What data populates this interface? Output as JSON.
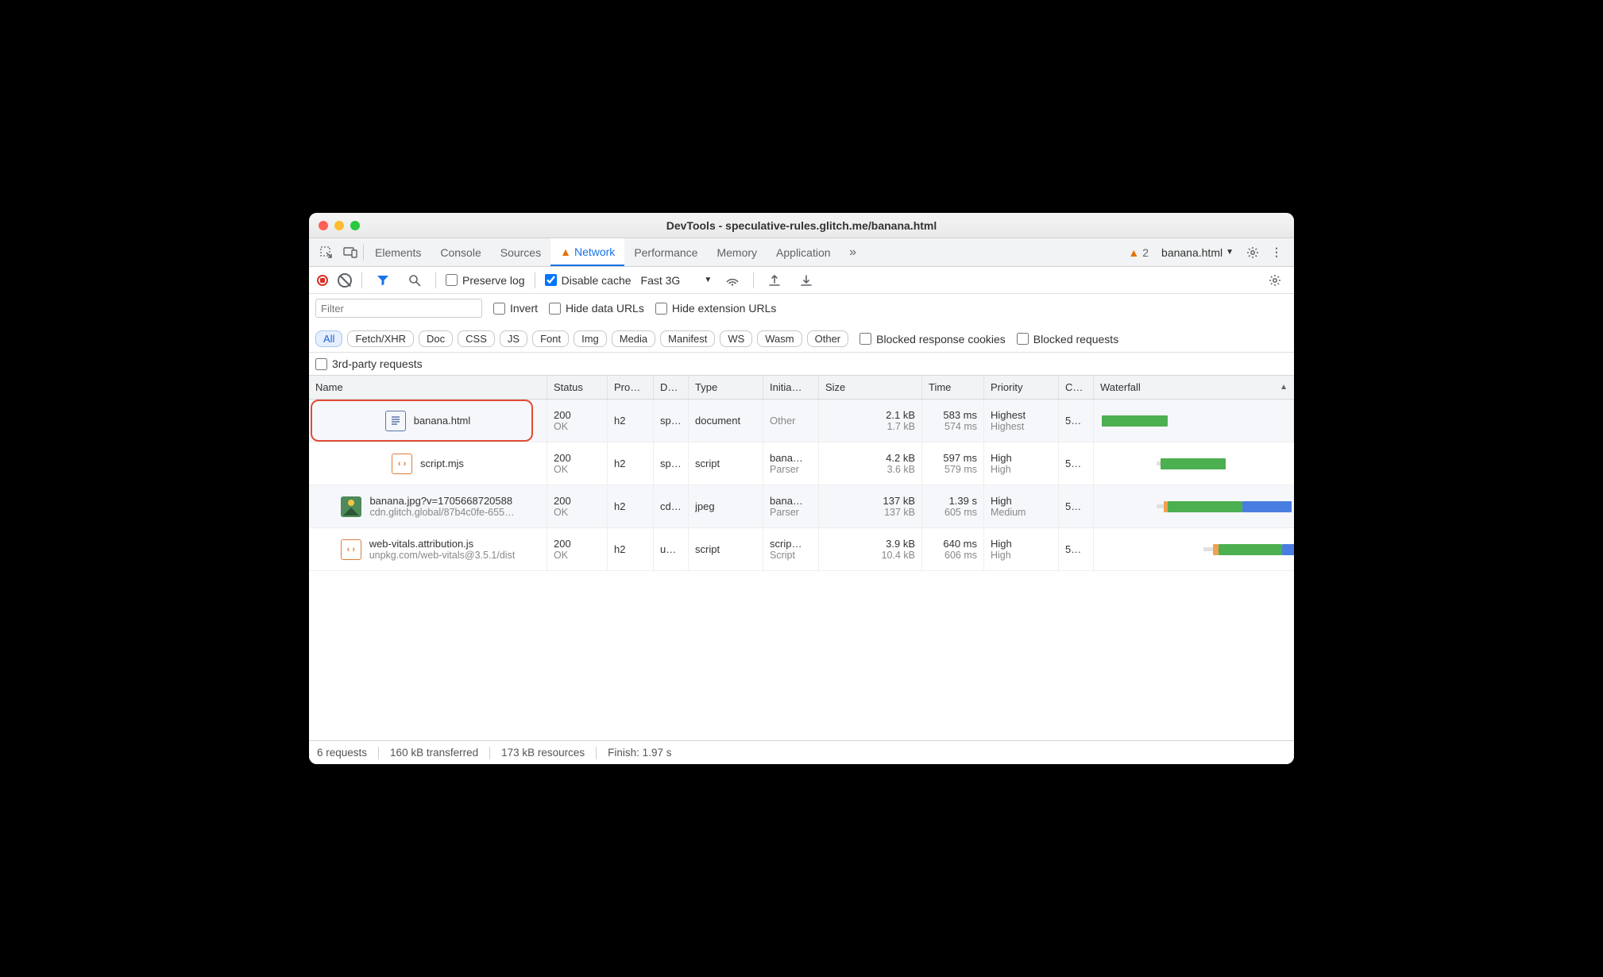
{
  "window": {
    "title": "DevTools - speculative-rules.glitch.me/banana.html"
  },
  "tabs": {
    "items": [
      "Elements",
      "Console",
      "Sources",
      "Network",
      "Performance",
      "Memory",
      "Application"
    ],
    "active": "Network",
    "warnCount": "2",
    "target": "banana.html"
  },
  "toolbar": {
    "preserveLog": "Preserve log",
    "disableCache": "Disable cache",
    "throttling": "Fast 3G"
  },
  "filters": {
    "placeholder": "Filter",
    "invert": "Invert",
    "hideData": "Hide data URLs",
    "hideExt": "Hide extension URLs",
    "types": [
      "All",
      "Fetch/XHR",
      "Doc",
      "CSS",
      "JS",
      "Font",
      "Img",
      "Media",
      "Manifest",
      "WS",
      "Wasm",
      "Other"
    ],
    "activeType": "All",
    "blockedCookies": "Blocked response cookies",
    "blockedReq": "Blocked requests",
    "thirdParty": "3rd-party requests"
  },
  "columns": {
    "name": "Name",
    "status": "Status",
    "proto": "Pro…",
    "domain": "D…",
    "type": "Type",
    "initiator": "Initia…",
    "size": "Size",
    "time": "Time",
    "priority": "Priority",
    "conn": "C…",
    "waterfall": "Waterfall"
  },
  "rows": [
    {
      "icon": "doc",
      "name": "banana.html",
      "sub": "",
      "status": "200",
      "statusText": "OK",
      "proto": "h2",
      "domain": "sp…",
      "type": "document",
      "initiator": "Other",
      "initiatorSub": "",
      "size": "2.1 kB",
      "sizeSub": "1.7 kB",
      "time": "583 ms",
      "timeSub": "574 ms",
      "prio": "Highest",
      "prioSub": "Highest",
      "conn": "5…",
      "wf": {
        "start": 1,
        "wait": 0,
        "green": 35,
        "blue": 0,
        "orange": 0
      }
    },
    {
      "icon": "js",
      "name": "script.mjs",
      "sub": "",
      "status": "200",
      "statusText": "OK",
      "proto": "h2",
      "domain": "sp…",
      "type": "script",
      "initiator": "bana…",
      "initiatorSub": "Parser",
      "size": "4.2 kB",
      "sizeSub": "3.6 kB",
      "time": "597 ms",
      "timeSub": "579 ms",
      "prio": "High",
      "prioSub": "High",
      "conn": "5…",
      "wf": {
        "start": 30,
        "wait": 2,
        "green": 35,
        "blue": 0,
        "orange": 0
      }
    },
    {
      "icon": "img",
      "name": "banana.jpg?v=1705668720588",
      "sub": "cdn.glitch.global/87b4c0fe-655…",
      "status": "200",
      "statusText": "OK",
      "proto": "h2",
      "domain": "cd…",
      "type": "jpeg",
      "initiator": "bana…",
      "initiatorSub": "Parser",
      "size": "137 kB",
      "sizeSub": "137 kB",
      "time": "1.39 s",
      "timeSub": "605 ms",
      "prio": "High",
      "prioSub": "Medium",
      "conn": "5…",
      "wf": {
        "start": 30,
        "wait": 4,
        "green": 40,
        "blue": 26,
        "orange": 2
      }
    },
    {
      "icon": "js",
      "name": "web-vitals.attribution.js",
      "sub": "unpkg.com/web-vitals@3.5.1/dist",
      "status": "200",
      "statusText": "OK",
      "proto": "h2",
      "domain": "un…",
      "type": "script",
      "initiator": "scrip…",
      "initiatorSub": "Script",
      "size": "3.9 kB",
      "sizeSub": "10.4 kB",
      "time": "640 ms",
      "timeSub": "606 ms",
      "prio": "High",
      "prioSub": "High",
      "conn": "5…",
      "wf": {
        "start": 55,
        "wait": 5,
        "green": 34,
        "blue": 7,
        "orange": 3
      }
    }
  ],
  "status": {
    "requests": "6 requests",
    "transferred": "160 kB transferred",
    "resources": "173 kB resources",
    "finish": "Finish: 1.97 s"
  }
}
